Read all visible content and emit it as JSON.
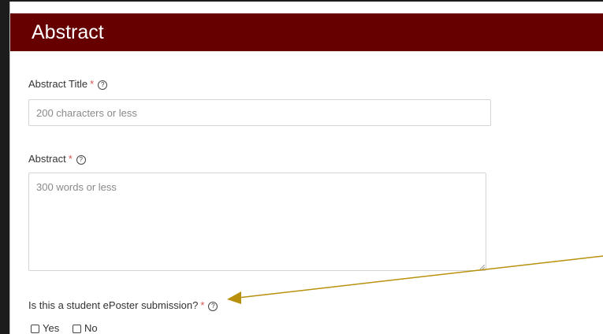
{
  "header": {
    "title": "Abstract",
    "background": "#660000"
  },
  "fields": {
    "abstract_title": {
      "label": "Abstract Title",
      "required_mark": "*",
      "placeholder": "200 characters or less",
      "value": ""
    },
    "abstract": {
      "label": "Abstract",
      "required_mark": "*",
      "placeholder": "300 words or less",
      "value": ""
    },
    "student_eposter": {
      "label": "Is this a student ePoster submission?",
      "required_mark": "*",
      "options": [
        {
          "label": "Yes",
          "checked": false
        },
        {
          "label": "No",
          "checked": false
        }
      ]
    }
  },
  "help_icon_glyph": "?",
  "annotation": {
    "arrow_color": "#b8900c"
  }
}
